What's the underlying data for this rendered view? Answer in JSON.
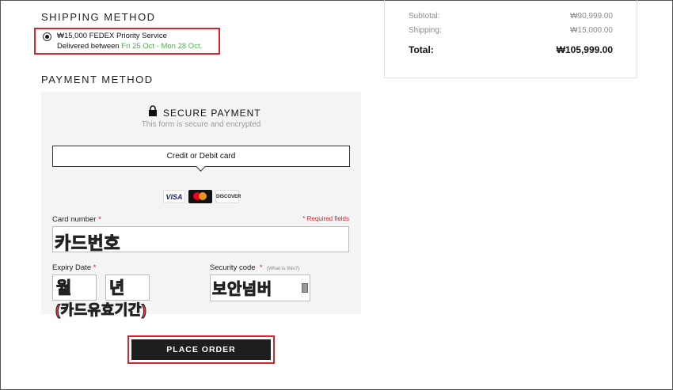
{
  "shipping": {
    "title": "SHIPPING METHOD",
    "option_line1": "₩15,000 FEDEX Priority Service",
    "option_delivered_prefix": "Delivered between ",
    "option_dates": "Fri 25 Oct - Mon 28 Oct."
  },
  "summary": {
    "subtotal_label": "Subtotal:",
    "subtotal_value": "₩90,999.00",
    "shipping_label": "Shipping:",
    "shipping_value": "₩15,000.00",
    "total_label": "Total:",
    "total_value": "₩105,999.00"
  },
  "payment": {
    "title": "PAYMENT METHOD",
    "secure_title": "SECURE PAYMENT",
    "secure_subtitle": "This form is secure and encrypted",
    "card_tab": "Credit or Debit card",
    "logos": {
      "visa": "VISA",
      "discover": "DISCOVER"
    },
    "card_number_label": "Card number",
    "required_mark": "*",
    "required_note": "* Required fields",
    "card_number_annotation": "카드번호",
    "expiry_label": "Expiry Date",
    "expiry_month_annotation": "월",
    "expiry_year_annotation": "년",
    "expiry_note_annotation": "(카드유효기간)",
    "security_label": "Security code",
    "security_whatis": "(What is this?)",
    "security_annotation": "보안넘버"
  },
  "place_order_label": "PLACE ORDER",
  "colors": {
    "highlight_red": "#d8232a",
    "delivery_green": "#4caf50",
    "button_dark": "#1e1e1e"
  }
}
